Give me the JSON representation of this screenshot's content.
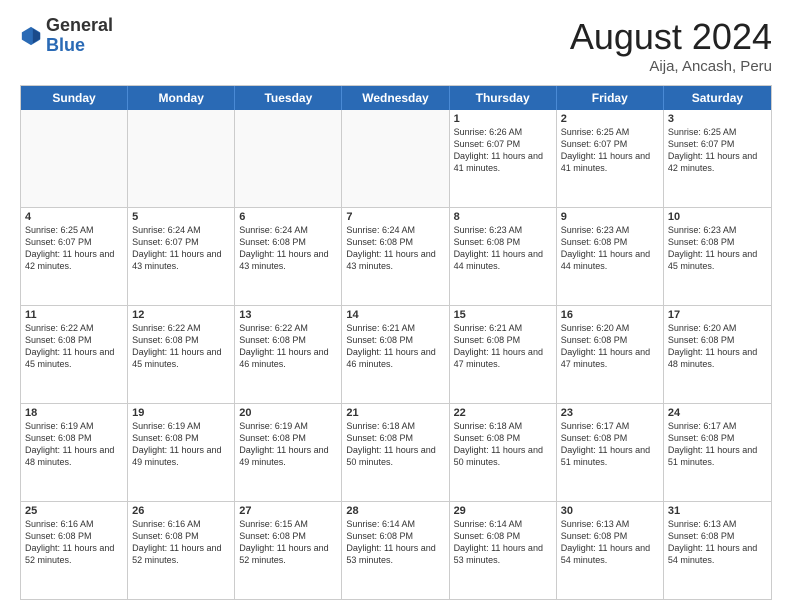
{
  "header": {
    "logo": {
      "general": "General",
      "blue": "Blue"
    },
    "title": "August 2024",
    "subtitle": "Aija, Ancash, Peru"
  },
  "dayHeaders": [
    "Sunday",
    "Monday",
    "Tuesday",
    "Wednesday",
    "Thursday",
    "Friday",
    "Saturday"
  ],
  "weeks": [
    [
      {
        "day": "",
        "empty": true
      },
      {
        "day": "",
        "empty": true
      },
      {
        "day": "",
        "empty": true
      },
      {
        "day": "",
        "empty": true
      },
      {
        "day": "1",
        "sunrise": "6:26 AM",
        "sunset": "6:07 PM",
        "daylight": "11 hours and 41 minutes."
      },
      {
        "day": "2",
        "sunrise": "6:25 AM",
        "sunset": "6:07 PM",
        "daylight": "11 hours and 41 minutes."
      },
      {
        "day": "3",
        "sunrise": "6:25 AM",
        "sunset": "6:07 PM",
        "daylight": "11 hours and 42 minutes."
      }
    ],
    [
      {
        "day": "4",
        "sunrise": "6:25 AM",
        "sunset": "6:07 PM",
        "daylight": "11 hours and 42 minutes."
      },
      {
        "day": "5",
        "sunrise": "6:24 AM",
        "sunset": "6:07 PM",
        "daylight": "11 hours and 43 minutes."
      },
      {
        "day": "6",
        "sunrise": "6:24 AM",
        "sunset": "6:08 PM",
        "daylight": "11 hours and 43 minutes."
      },
      {
        "day": "7",
        "sunrise": "6:24 AM",
        "sunset": "6:08 PM",
        "daylight": "11 hours and 43 minutes."
      },
      {
        "day": "8",
        "sunrise": "6:23 AM",
        "sunset": "6:08 PM",
        "daylight": "11 hours and 44 minutes."
      },
      {
        "day": "9",
        "sunrise": "6:23 AM",
        "sunset": "6:08 PM",
        "daylight": "11 hours and 44 minutes."
      },
      {
        "day": "10",
        "sunrise": "6:23 AM",
        "sunset": "6:08 PM",
        "daylight": "11 hours and 45 minutes."
      }
    ],
    [
      {
        "day": "11",
        "sunrise": "6:22 AM",
        "sunset": "6:08 PM",
        "daylight": "11 hours and 45 minutes."
      },
      {
        "day": "12",
        "sunrise": "6:22 AM",
        "sunset": "6:08 PM",
        "daylight": "11 hours and 45 minutes."
      },
      {
        "day": "13",
        "sunrise": "6:22 AM",
        "sunset": "6:08 PM",
        "daylight": "11 hours and 46 minutes."
      },
      {
        "day": "14",
        "sunrise": "6:21 AM",
        "sunset": "6:08 PM",
        "daylight": "11 hours and 46 minutes."
      },
      {
        "day": "15",
        "sunrise": "6:21 AM",
        "sunset": "6:08 PM",
        "daylight": "11 hours and 47 minutes."
      },
      {
        "day": "16",
        "sunrise": "6:20 AM",
        "sunset": "6:08 PM",
        "daylight": "11 hours and 47 minutes."
      },
      {
        "day": "17",
        "sunrise": "6:20 AM",
        "sunset": "6:08 PM",
        "daylight": "11 hours and 48 minutes."
      }
    ],
    [
      {
        "day": "18",
        "sunrise": "6:19 AM",
        "sunset": "6:08 PM",
        "daylight": "11 hours and 48 minutes."
      },
      {
        "day": "19",
        "sunrise": "6:19 AM",
        "sunset": "6:08 PM",
        "daylight": "11 hours and 49 minutes."
      },
      {
        "day": "20",
        "sunrise": "6:19 AM",
        "sunset": "6:08 PM",
        "daylight": "11 hours and 49 minutes."
      },
      {
        "day": "21",
        "sunrise": "6:18 AM",
        "sunset": "6:08 PM",
        "daylight": "11 hours and 50 minutes."
      },
      {
        "day": "22",
        "sunrise": "6:18 AM",
        "sunset": "6:08 PM",
        "daylight": "11 hours and 50 minutes."
      },
      {
        "day": "23",
        "sunrise": "6:17 AM",
        "sunset": "6:08 PM",
        "daylight": "11 hours and 51 minutes."
      },
      {
        "day": "24",
        "sunrise": "6:17 AM",
        "sunset": "6:08 PM",
        "daylight": "11 hours and 51 minutes."
      }
    ],
    [
      {
        "day": "25",
        "sunrise": "6:16 AM",
        "sunset": "6:08 PM",
        "daylight": "11 hours and 52 minutes."
      },
      {
        "day": "26",
        "sunrise": "6:16 AM",
        "sunset": "6:08 PM",
        "daylight": "11 hours and 52 minutes."
      },
      {
        "day": "27",
        "sunrise": "6:15 AM",
        "sunset": "6:08 PM",
        "daylight": "11 hours and 52 minutes."
      },
      {
        "day": "28",
        "sunrise": "6:14 AM",
        "sunset": "6:08 PM",
        "daylight": "11 hours and 53 minutes."
      },
      {
        "day": "29",
        "sunrise": "6:14 AM",
        "sunset": "6:08 PM",
        "daylight": "11 hours and 53 minutes."
      },
      {
        "day": "30",
        "sunrise": "6:13 AM",
        "sunset": "6:08 PM",
        "daylight": "11 hours and 54 minutes."
      },
      {
        "day": "31",
        "sunrise": "6:13 AM",
        "sunset": "6:08 PM",
        "daylight": "11 hours and 54 minutes."
      }
    ]
  ]
}
